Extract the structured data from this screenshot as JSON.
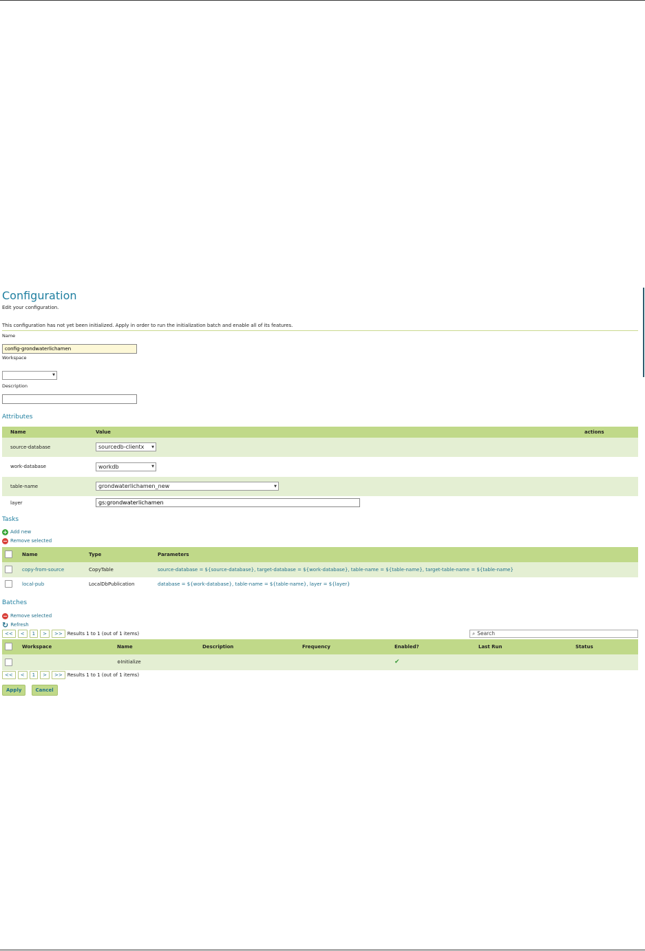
{
  "title": "Configuration",
  "subtitle": "Edit your configuration.",
  "notice": "This configuration has not yet been initialized. Apply in order to run the initialization batch and enable all of its features.",
  "form": {
    "name_label": "Name",
    "name_value": "config-grondwaterlichamen",
    "workspace_label": "Workspace",
    "workspace_value": "",
    "description_label": "Description",
    "description_value": ""
  },
  "attributes": {
    "heading": "Attributes",
    "columns": [
      "Name",
      "Value",
      "actions"
    ],
    "rows": [
      {
        "name": "source-database",
        "value": "sourcedb-clientx"
      },
      {
        "name": "work-database",
        "value": "workdb"
      },
      {
        "name": "table-name",
        "value": "grondwaterlichamen_new"
      },
      {
        "name": "layer",
        "value": "gs:grondwaterlichamen"
      }
    ]
  },
  "tasks": {
    "heading": "Tasks",
    "add_new": "Add new",
    "remove_selected": "Remove selected",
    "columns": [
      "Name",
      "Type",
      "Parameters"
    ],
    "rows": [
      {
        "name": "copy-from-source",
        "type": "CopyTable",
        "params": "source-database = ${source-database}, target-database = ${work-database}, table-name = ${table-name}, target-table-name = ${table-name}"
      },
      {
        "name": "local-pub",
        "type": "LocalDbPublication",
        "params": "database = ${work-database}, table-name = ${table-name}, layer = ${layer}"
      }
    ]
  },
  "batches": {
    "heading": "Batches",
    "remove_selected": "Remove selected",
    "refresh": "Refresh",
    "pager": {
      "first": "<<",
      "prev": "<",
      "page": "1",
      "next": ">",
      "last": ">>",
      "results": "Results 1 to 1 (out of 1 items)"
    },
    "search_placeholder": "Search",
    "columns": [
      "Workspace",
      "Name",
      "Description",
      "Frequency",
      "Enabled?",
      "Last Run",
      "Status"
    ],
    "rows": [
      {
        "workspace": "",
        "name": "Initialize",
        "description": "",
        "frequency": "",
        "enabled": "✔",
        "last_run": "",
        "status": ""
      }
    ]
  },
  "buttons": {
    "apply": "Apply",
    "cancel": "Cancel"
  }
}
